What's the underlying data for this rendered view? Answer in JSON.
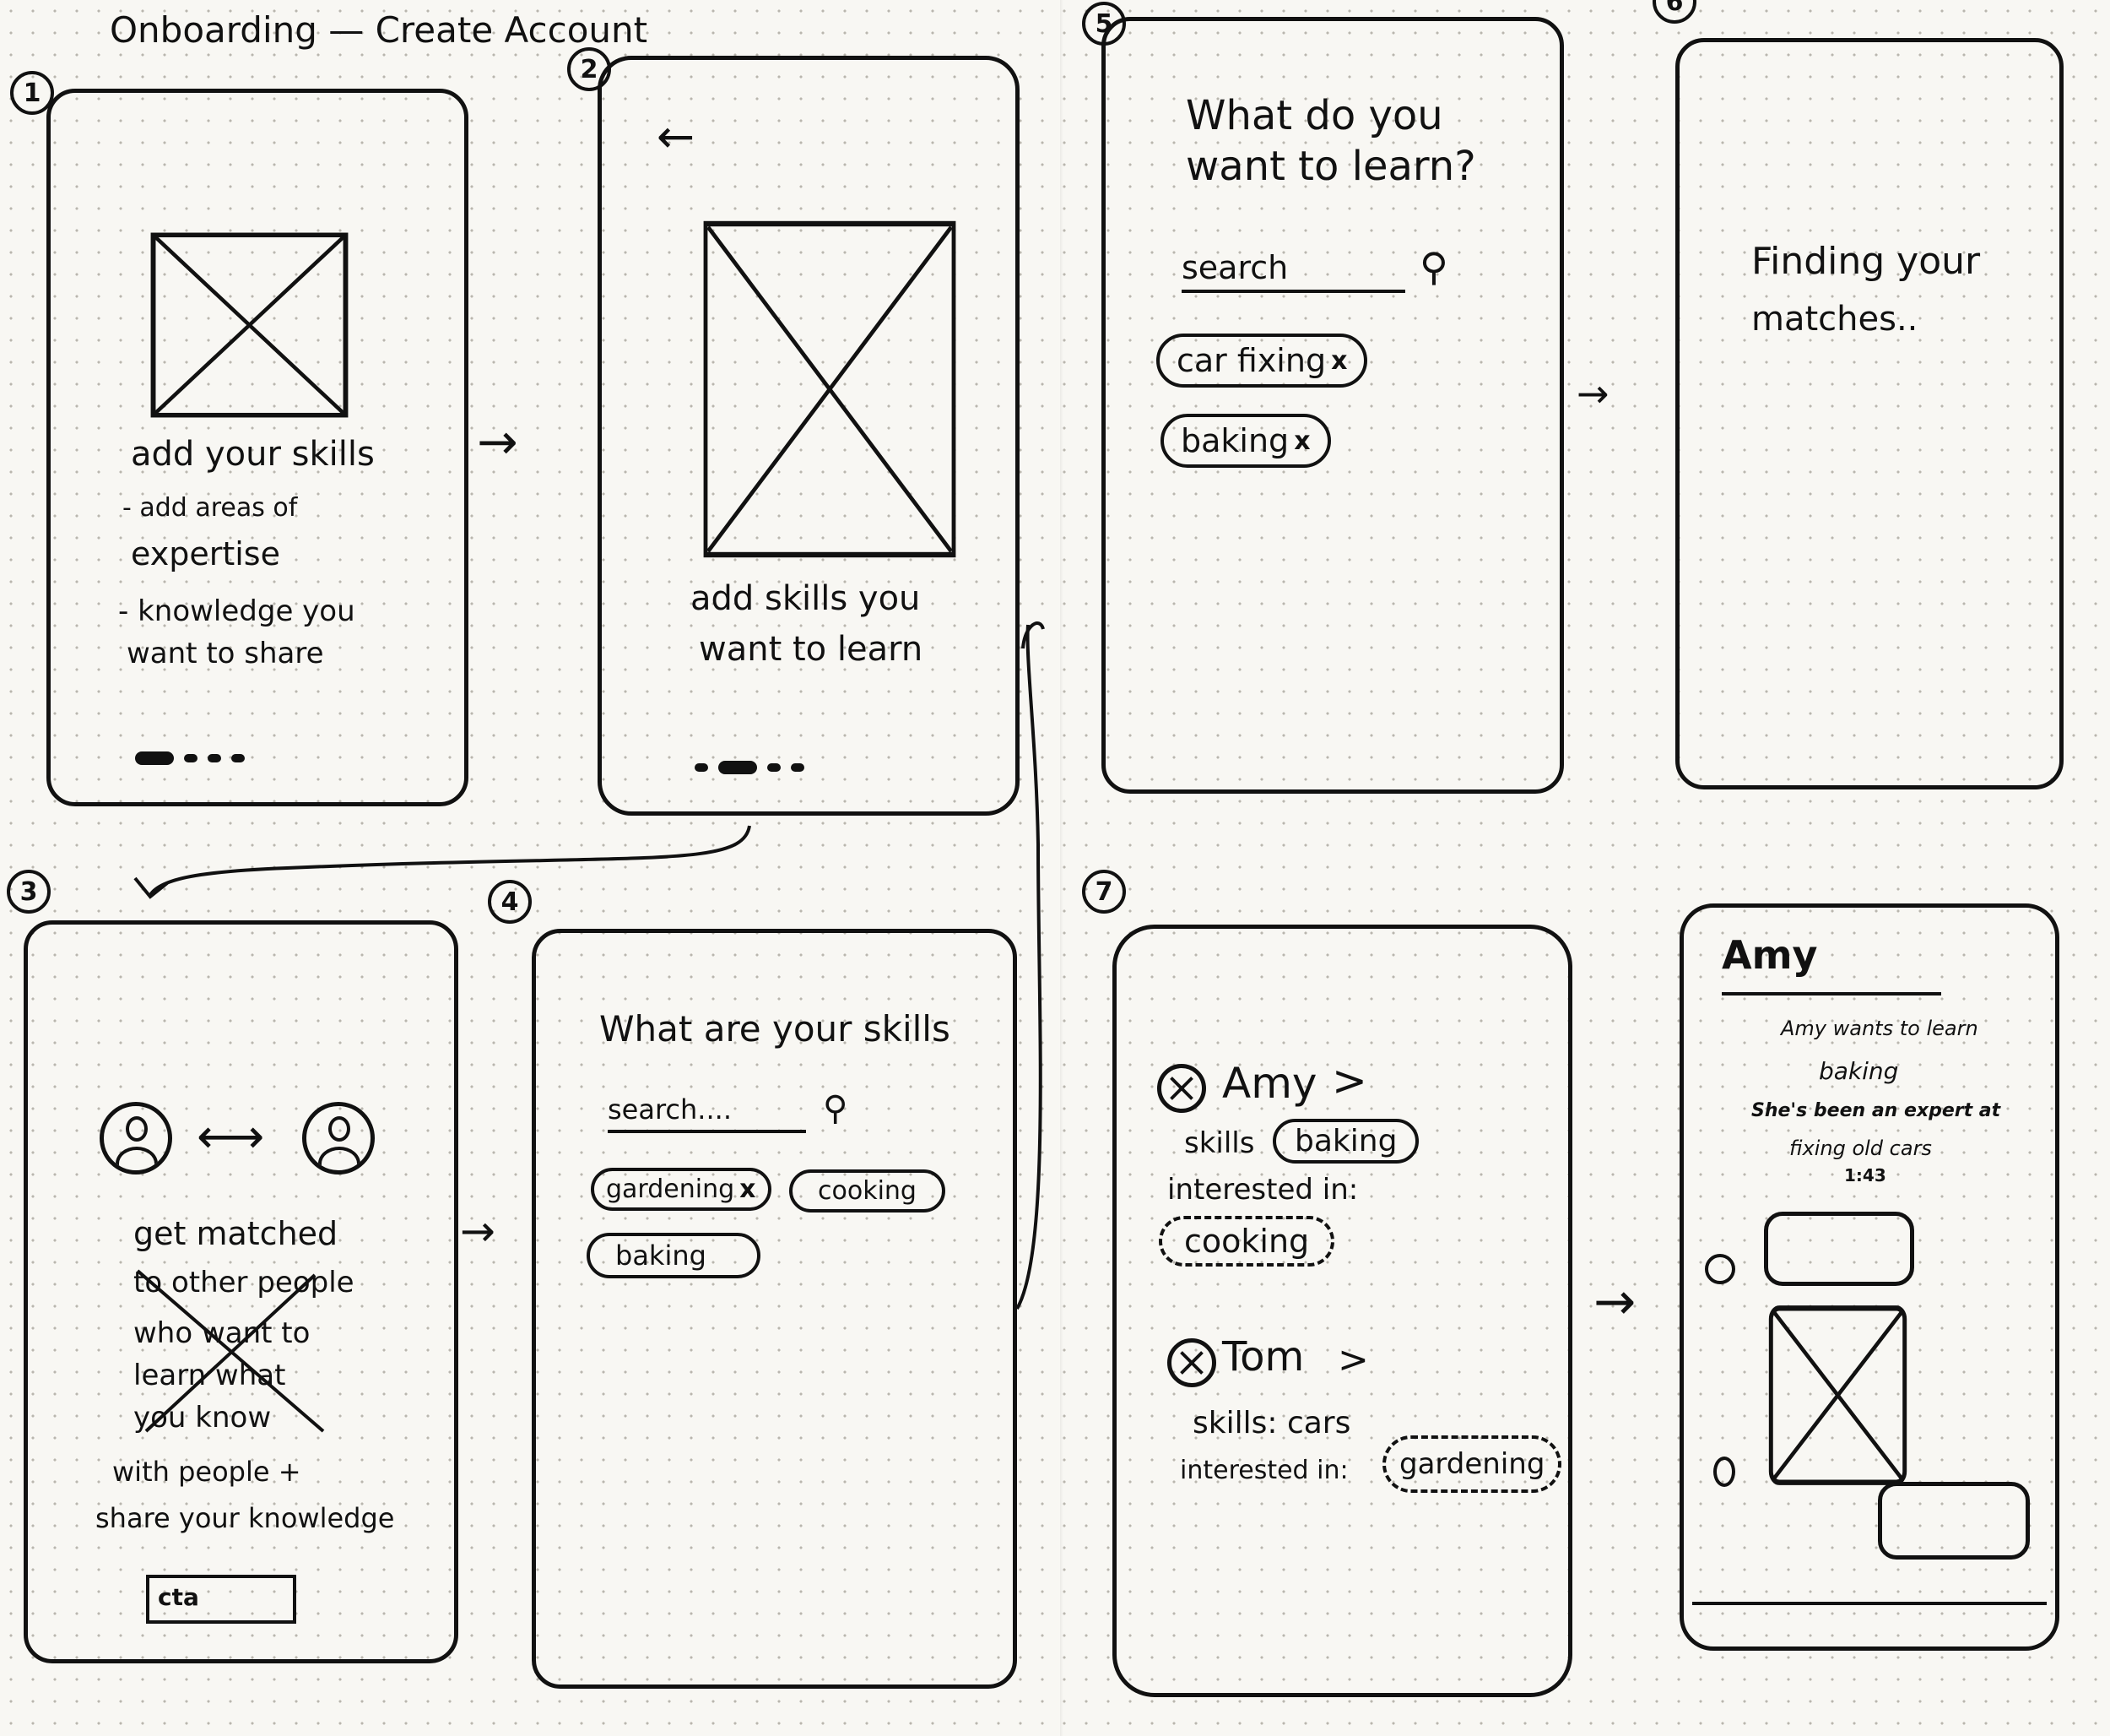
{
  "page_title": "Onboarding — Create Account",
  "screens": {
    "s1": {
      "number": "1",
      "heading": "add your skills",
      "line1": "- add areas of",
      "line2": "expertise",
      "line3": "- knowledge you",
      "line4": "want to share"
    },
    "s2": {
      "number": "2",
      "back": "←",
      "line1": "add skills you",
      "line2": "want to learn"
    },
    "s3": {
      "number": "3",
      "line1": "get matched",
      "line2": "to other people",
      "line3": "who want to",
      "line4": "learn what",
      "line5": "you know",
      "line6": "with people +",
      "line7": "share your knowledge",
      "button": "cta"
    },
    "s4": {
      "number": "4",
      "title": "What are your skills",
      "search": "search....",
      "chips": [
        "gardening",
        "cooking",
        "baking"
      ]
    },
    "s5": {
      "number": "5",
      "title1": "What do you",
      "title2": "want to learn?",
      "search": "search",
      "chips": [
        "car fixing",
        "baking"
      ]
    },
    "s6": {
      "number": "6",
      "line1": "Finding your",
      "line2": "matches.."
    },
    "s7": {
      "number": "7",
      "match1": {
        "name": "Amy",
        "skills_label": "skills",
        "skill": "baking",
        "interested_label": "interested in:",
        "interest": "cooking"
      },
      "match2": {
        "name": "Tom",
        "skills_text": "skills: cars",
        "interested_label": "interested in:",
        "interest": "gardening"
      }
    },
    "s8": {
      "name": "Amy",
      "line1": "Amy wants to learn",
      "line2": "baking",
      "line3": "She's been an expert at",
      "line4": "fixing old cars",
      "time": "1:43"
    }
  },
  "arrow_glyph": "→",
  "colors": {
    "ink": "#111111",
    "paper": "#f8f7f3",
    "dot": "#b9b6ae"
  }
}
